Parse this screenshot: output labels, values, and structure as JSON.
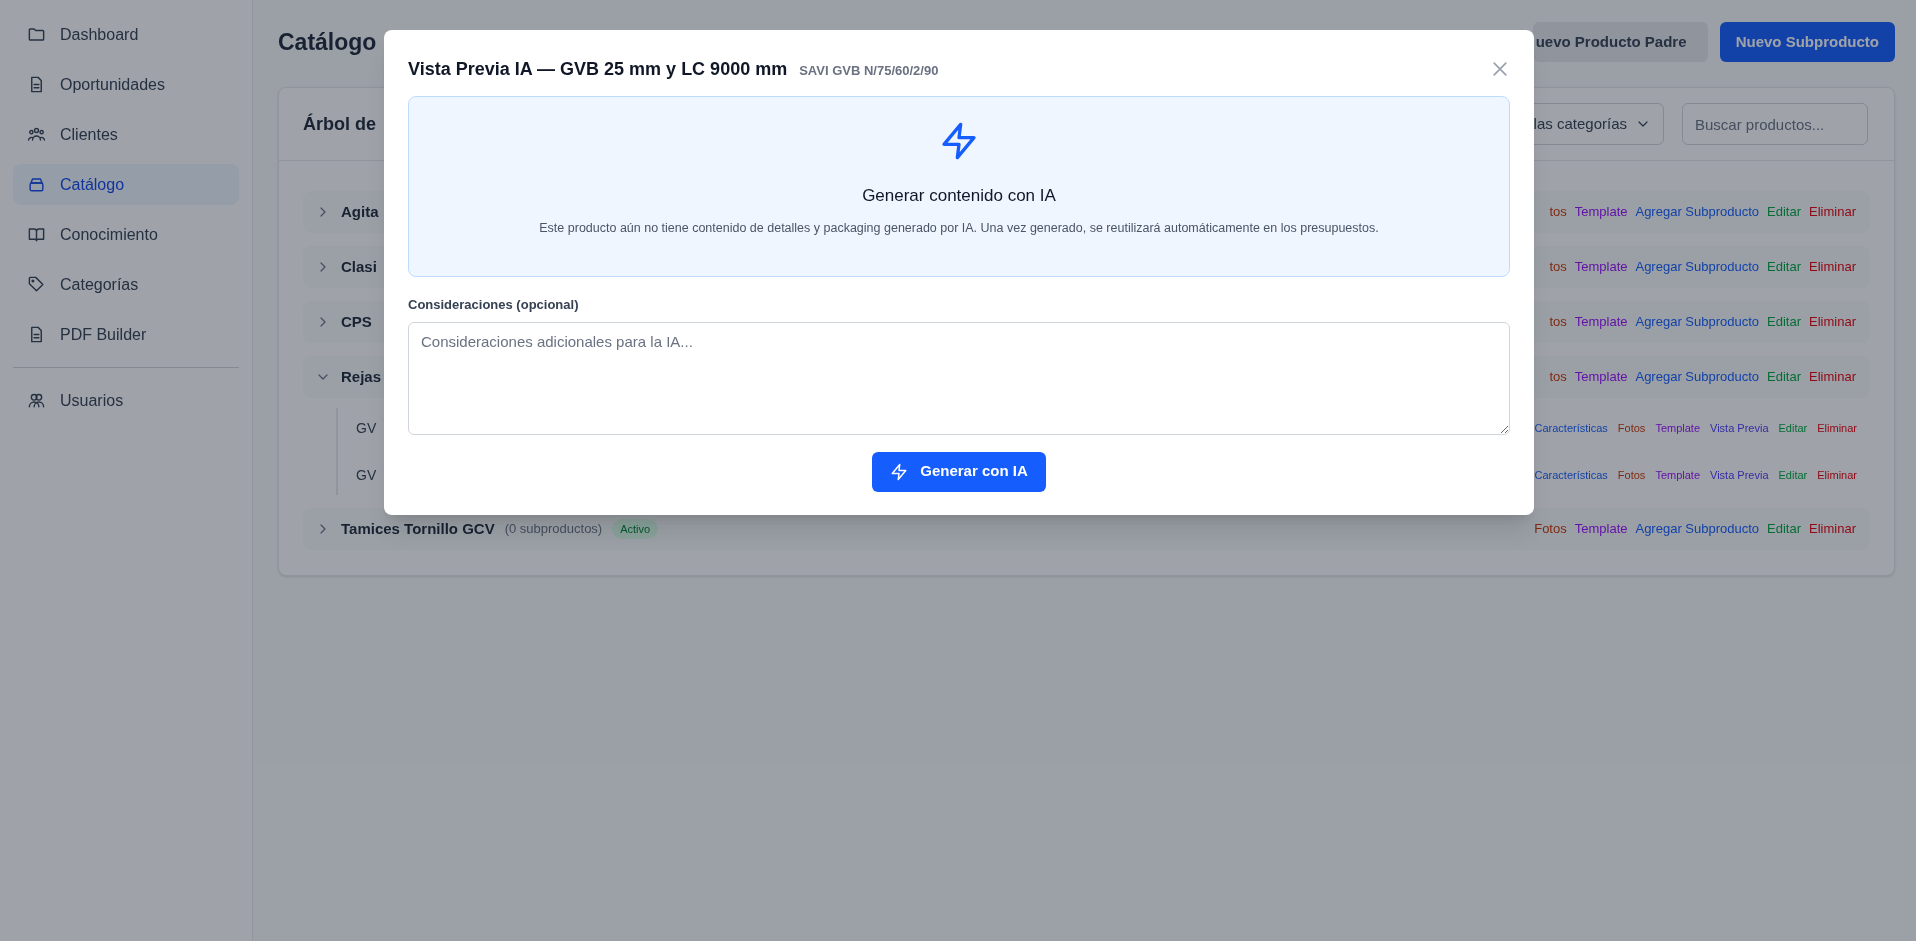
{
  "sidebar": {
    "items": [
      {
        "label": "Dashboard",
        "selected": false
      },
      {
        "label": "Oportunidades",
        "selected": false
      },
      {
        "label": "Clientes",
        "selected": false
      },
      {
        "label": "Catálogo",
        "selected": true
      },
      {
        "label": "Conocimiento",
        "selected": false
      },
      {
        "label": "Categorías",
        "selected": false
      },
      {
        "label": "PDF Builder",
        "selected": false
      }
    ],
    "bottom_items": [
      {
        "label": "Usuarios",
        "selected": false
      }
    ]
  },
  "header": {
    "title": "Catálogo",
    "buttons": [
      {
        "label": "uevo Producto Padre",
        "kind": "secondary"
      },
      {
        "label": "Nuevo Subproducto",
        "kind": "primary"
      }
    ]
  },
  "card": {
    "title": "Árbol de",
    "category_filter": "las categorías",
    "search": {
      "placeholder": "Buscar productos..."
    },
    "rows": [
      {
        "name": "Agita",
        "expanded": false,
        "actions": [
          {
            "label": "tos",
            "kind": "photos"
          },
          {
            "label": "Template",
            "kind": "template"
          },
          {
            "label": "Agregar Subproducto",
            "kind": "add"
          },
          {
            "label": "Editar",
            "kind": "edit"
          },
          {
            "label": "Eliminar",
            "kind": "delete"
          }
        ]
      },
      {
        "name": "Clasi",
        "expanded": false,
        "actions": [
          {
            "label": "tos",
            "kind": "photos"
          },
          {
            "label": "Template",
            "kind": "template"
          },
          {
            "label": "Agregar Subproducto",
            "kind": "add"
          },
          {
            "label": "Editar",
            "kind": "edit"
          },
          {
            "label": "Eliminar",
            "kind": "delete"
          }
        ]
      },
      {
        "name": "CPS",
        "expanded": false,
        "actions": [
          {
            "label": "tos",
            "kind": "photos"
          },
          {
            "label": "Template",
            "kind": "template"
          },
          {
            "label": "Agregar Subproducto",
            "kind": "add"
          },
          {
            "label": "Editar",
            "kind": "edit"
          },
          {
            "label": "Eliminar",
            "kind": "delete"
          }
        ]
      },
      {
        "name": "Rejas",
        "expanded": true,
        "actions": [
          {
            "label": "tos",
            "kind": "photos"
          },
          {
            "label": "Template",
            "kind": "template"
          },
          {
            "label": "Agregar Subproducto",
            "kind": "add"
          },
          {
            "label": "Editar",
            "kind": "edit"
          },
          {
            "label": "Eliminar",
            "kind": "delete"
          }
        ],
        "children": [
          {
            "name": "GV",
            "actions": [
              {
                "label": "Características",
                "kind": "features"
              },
              {
                "label": "Fotos",
                "kind": "photos"
              },
              {
                "label": "Template",
                "kind": "template"
              },
              {
                "label": "Vista Previa",
                "kind": "preview"
              },
              {
                "label": "Editar",
                "kind": "edit"
              },
              {
                "label": "Eliminar",
                "kind": "delete"
              }
            ]
          },
          {
            "name": "GV",
            "actions": [
              {
                "label": "Características",
                "kind": "features"
              },
              {
                "label": "Fotos",
                "kind": "photos"
              },
              {
                "label": "Template",
                "kind": "template"
              },
              {
                "label": "Vista Previa",
                "kind": "preview"
              },
              {
                "label": "Editar",
                "kind": "edit"
              },
              {
                "label": "Eliminar",
                "kind": "delete"
              }
            ]
          }
        ]
      },
      {
        "name": "Tamices Tornillo GCV",
        "count": "(0 subproductos)",
        "badge": "Activo",
        "expanded": false,
        "actions": [
          {
            "label": "Fotos",
            "kind": "photos"
          },
          {
            "label": "Template",
            "kind": "template"
          },
          {
            "label": "Agregar Subproducto",
            "kind": "add"
          },
          {
            "label": "Editar",
            "kind": "edit"
          },
          {
            "label": "Eliminar",
            "kind": "delete"
          }
        ]
      }
    ]
  },
  "modal": {
    "title": "Vista Previa IA — GVB 25 mm y LC 9000 mm",
    "subtitle": "SAVI GVB N/75/60/2/90",
    "ai_panel": {
      "heading": "Generar contenido con IA",
      "description": "Este producto aún no tiene contenido de detalles y packaging generado por IA. Una vez generado, se reutilizará automáticamente en los presupuestos."
    },
    "considerations": {
      "label": "Consideraciones (opcional)",
      "placeholder": "Consideraciones adicionales para la IA..."
    },
    "generate_button": "Generar con IA"
  }
}
